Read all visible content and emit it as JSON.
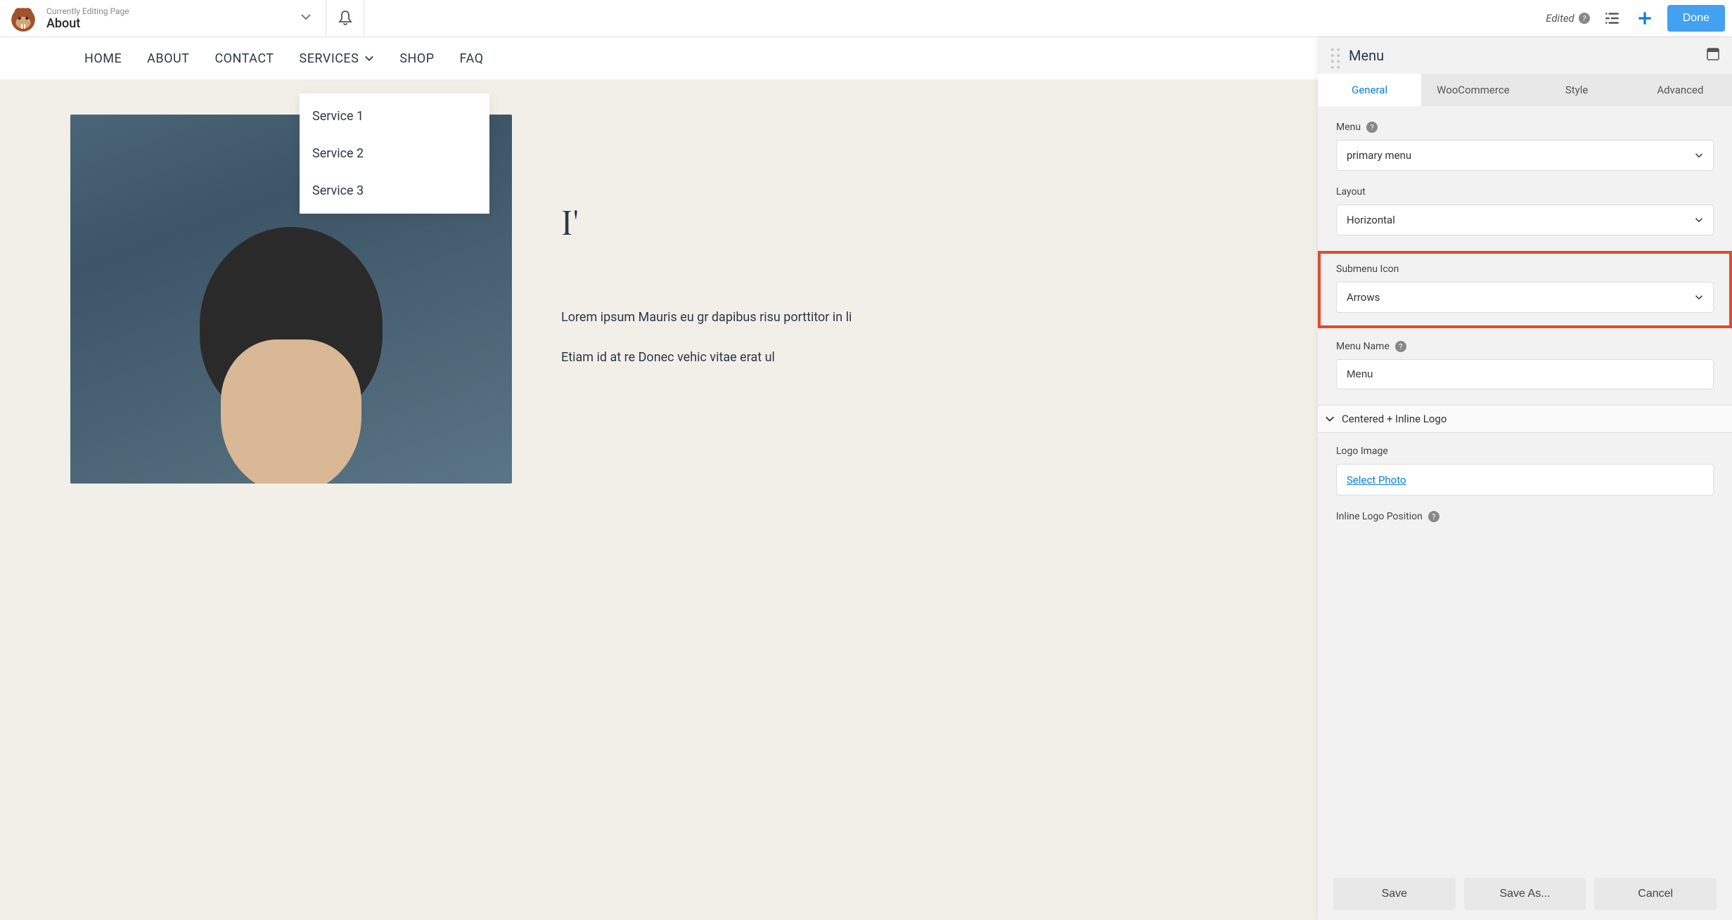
{
  "topBar": {
    "pageLabel": "Currently Editing Page",
    "pageTitle": "About",
    "editedLabel": "Edited",
    "doneLabel": "Done"
  },
  "nav": {
    "items": [
      "HOME",
      "ABOUT",
      "CONTACT",
      "SERVICES",
      "SHOP",
      "FAQ"
    ],
    "submenu": [
      "Service 1",
      "Service 2",
      "Service 3"
    ]
  },
  "content": {
    "heading": "I'",
    "para1": "Lorem ipsum Mauris eu gr dapibus risu porttitor in li",
    "para2": "Etiam id at re Donec vehic vitae erat ul"
  },
  "panel": {
    "title": "Menu",
    "tabs": [
      "General",
      "WooCommerce",
      "Style",
      "Advanced"
    ],
    "fields": {
      "menuLabel": "Menu",
      "menuValue": "primary menu",
      "layoutLabel": "Layout",
      "layoutValue": "Horizontal",
      "submenuIconLabel": "Submenu Icon",
      "submenuIconValue": "Arrows",
      "menuNameLabel": "Menu Name",
      "menuNameValue": "Menu",
      "sectionLabel": "Centered + Inline Logo",
      "logoImageLabel": "Logo Image",
      "selectPhotoLabel": "Select Photo",
      "inlineLogoPosLabel": "Inline Logo Position"
    },
    "footer": {
      "save": "Save",
      "saveAs": "Save As...",
      "cancel": "Cancel"
    }
  }
}
